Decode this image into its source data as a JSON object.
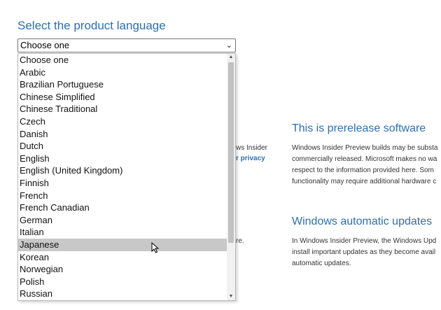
{
  "heading": "Select the product language",
  "select": {
    "value": "Choose one"
  },
  "dropdown": {
    "options": [
      "Choose one",
      "Arabic",
      "Brazilian Portuguese",
      "Chinese Simplified",
      "Chinese Traditional",
      "Czech",
      "Danish",
      "Dutch",
      "English",
      "English (United Kingdom)",
      "Finnish",
      "French",
      "French Canadian",
      "German",
      "Italian",
      "Japanese",
      "Korean",
      "Norwegian",
      "Polish",
      "Russian"
    ],
    "highlighted": "Japanese"
  },
  "background_left": {
    "fragment_1": "ws Insider",
    "fragment_2": "r privacy",
    "fragment_3": "re."
  },
  "prerelease": {
    "title": "This is prerelease software",
    "lines": [
      "Windows Insider Preview builds may be substa",
      "commercially released. Microsoft makes no wa",
      "respect to the information provided here. Som",
      "functionality may require additional hardware c"
    ]
  },
  "updates": {
    "title": "Windows automatic updates",
    "lines": [
      "In Windows Insider Preview, the Windows Upd",
      "install important updates as they become avail",
      "automatic updates."
    ]
  }
}
